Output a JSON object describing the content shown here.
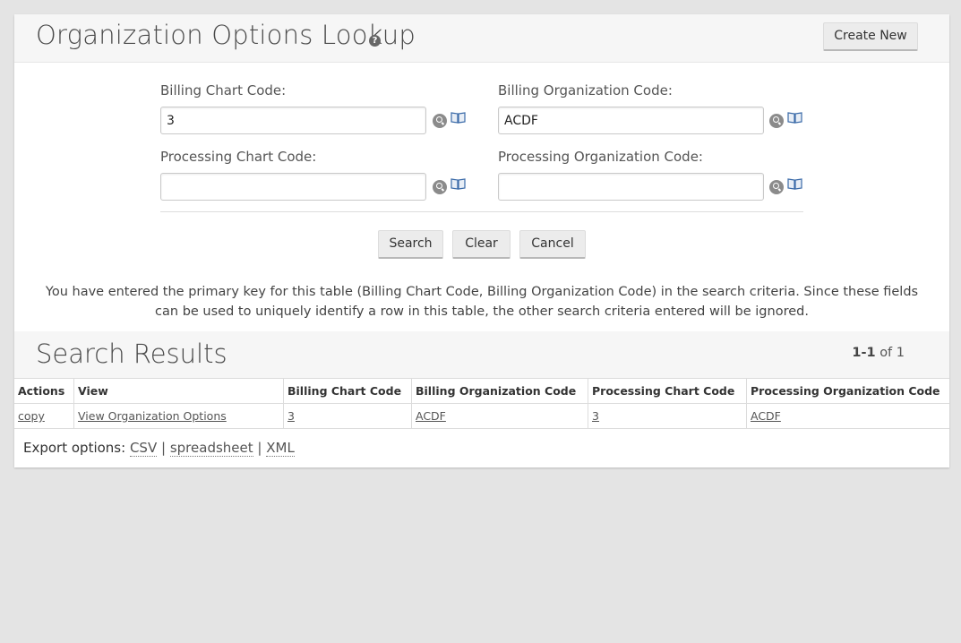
{
  "header": {
    "title": "Organization Options Lookup",
    "help_icon": "question-circle-icon",
    "create_new_label": "Create New"
  },
  "form": {
    "billing_chart_code": {
      "label": "Billing Chart Code:",
      "value": "3"
    },
    "billing_org_code": {
      "label": "Billing Organization Code:",
      "value": "ACDF"
    },
    "processing_chart_code": {
      "label": "Processing Chart Code:",
      "value": ""
    },
    "processing_org_code": {
      "label": "Processing Organization Code:",
      "value": ""
    },
    "lookup_icon": "magnifier-icon",
    "inquiry_icon": "book-icon"
  },
  "actions": {
    "search_label": "Search",
    "clear_label": "Clear",
    "cancel_label": "Cancel"
  },
  "message": "You have entered the primary key for this table (Billing Chart Code, Billing Organization Code) in the search criteria. Since these fields can be used to uniquely identify a row in this table, the other search criteria entered will be ignored.",
  "results": {
    "title": "Search Results",
    "pager": {
      "range": "1-1",
      "of_text": "of 1"
    },
    "columns": [
      "Actions",
      "View",
      "Billing Chart Code",
      "Billing Organization Code",
      "Processing Chart Code",
      "Processing Organization Code"
    ],
    "rows": [
      [
        "copy",
        "View Organization Options",
        "3",
        "ACDF",
        "3",
        "ACDF"
      ]
    ]
  },
  "export": {
    "label": "Export options:",
    "csv": "CSV",
    "spreadsheet": "spreadsheet",
    "xml": "XML",
    "separator": "|"
  }
}
